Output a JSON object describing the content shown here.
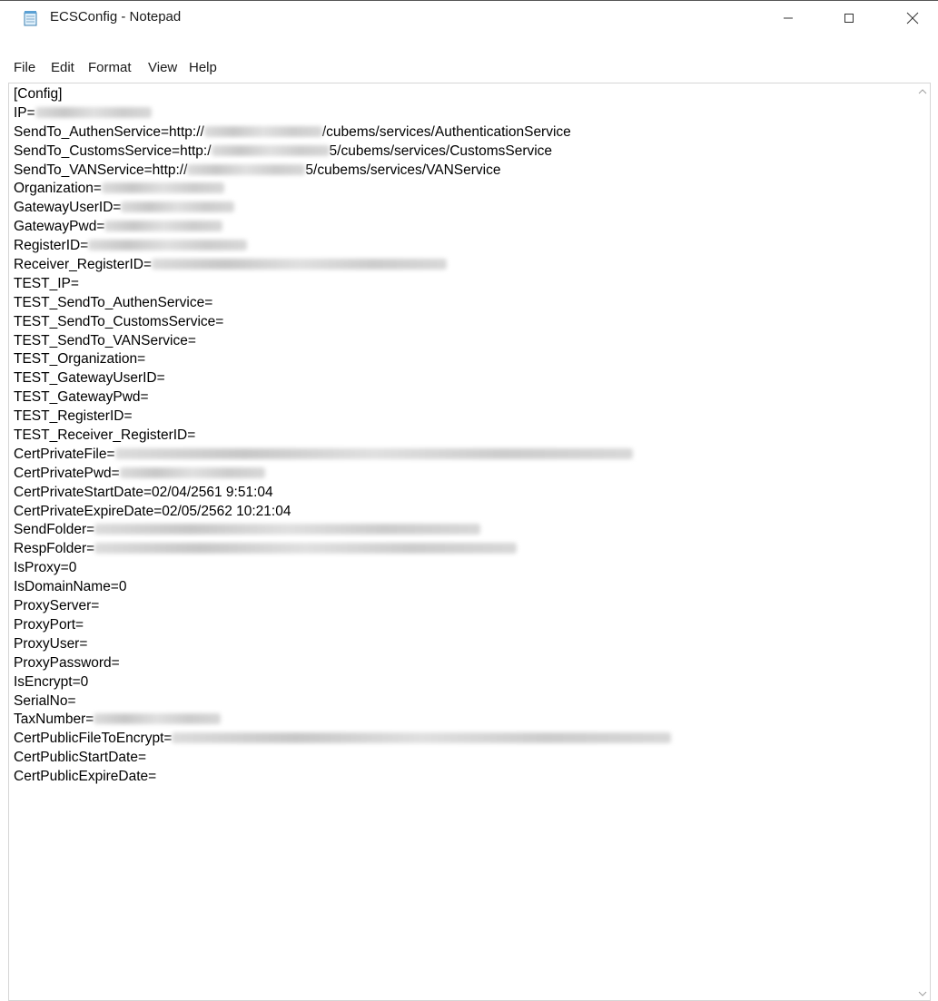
{
  "window": {
    "title": "ECSConfig - Notepad",
    "icon": "notepad-icon",
    "controls": [
      "minimize-icon",
      "maximize-icon",
      "close-icon"
    ]
  },
  "menu": {
    "file": "File",
    "edit": "Edit",
    "format": "Format",
    "view": "View",
    "help": "Help"
  },
  "content": {
    "lines": [
      {
        "pre": "[Config]"
      },
      {
        "pre": "IP=",
        "redacted": true
      },
      {
        "pre": "SendTo_AuthenService=http://",
        "redacted": true,
        "post": "/cubems/services/AuthenticationService"
      },
      {
        "pre": "SendTo_CustomsService=http:/",
        "redacted": true,
        "post": "5/cubems/services/CustomsService"
      },
      {
        "pre": "SendTo_VANService=http://",
        "redacted": true,
        "post": "5/cubems/services/VANService"
      },
      {
        "pre": "Organization=",
        "redacted": true
      },
      {
        "pre": "GatewayUserID=",
        "redacted": true
      },
      {
        "pre": "GatewayPwd=",
        "redacted": true
      },
      {
        "pre": "RegisterID=",
        "redacted": true
      },
      {
        "pre": "Receiver_RegisterID=",
        "redacted": true
      },
      {
        "pre": "TEST_IP="
      },
      {
        "pre": "TEST_SendTo_AuthenService="
      },
      {
        "pre": "TEST_SendTo_CustomsService="
      },
      {
        "pre": "TEST_SendTo_VANService="
      },
      {
        "pre": "TEST_Organization="
      },
      {
        "pre": "TEST_GatewayUserID="
      },
      {
        "pre": "TEST_GatewayPwd="
      },
      {
        "pre": "TEST_RegisterID="
      },
      {
        "pre": "TEST_Receiver_RegisterID="
      },
      {
        "pre": "CertPrivateFile=",
        "redacted": true
      },
      {
        "pre": "CertPrivatePwd=",
        "redacted": true
      },
      {
        "pre": "CertPrivateStartDate=02/04/2561 9:51:04"
      },
      {
        "pre": "CertPrivateExpireDate=02/05/2562 10:21:04"
      },
      {
        "pre": "SendFolder=",
        "redacted": true
      },
      {
        "pre": "RespFolder=",
        "redacted": true
      },
      {
        "pre": "IsProxy=0"
      },
      {
        "pre": "IsDomainName=0"
      },
      {
        "pre": "ProxyServer="
      },
      {
        "pre": "ProxyPort="
      },
      {
        "pre": "ProxyUser="
      },
      {
        "pre": "ProxyPassword="
      },
      {
        "pre": "IsEncrypt=0"
      },
      {
        "pre": "SerialNo="
      },
      {
        "pre": "TaxNumber=",
        "redacted": true
      },
      {
        "pre": "CertPublicFileToEncrypt=",
        "redacted": true
      },
      {
        "pre": "CertPublicStartDate="
      },
      {
        "pre": "CertPublicExpireDate="
      }
    ]
  }
}
